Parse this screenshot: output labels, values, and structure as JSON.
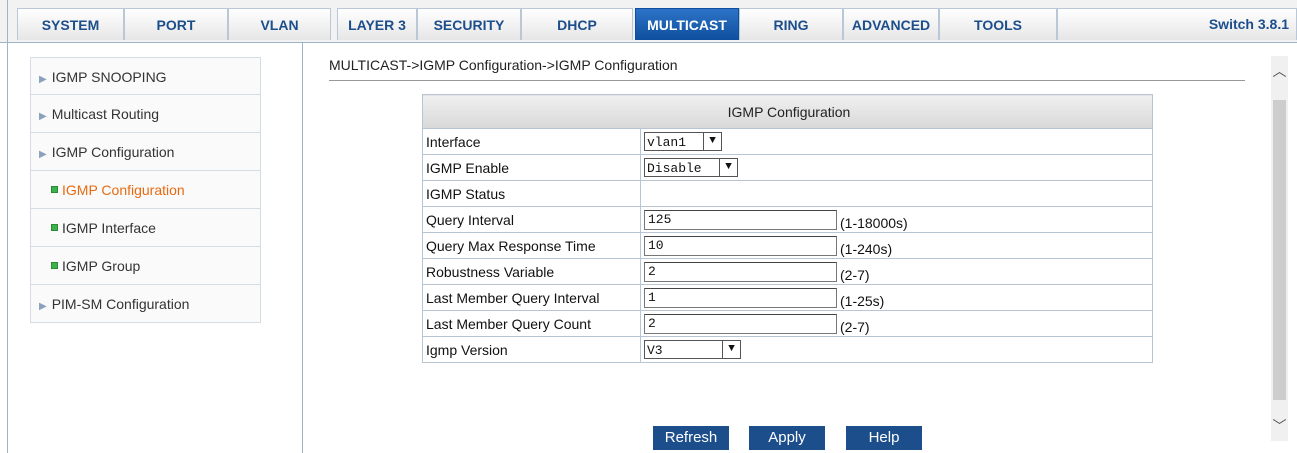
{
  "nav": {
    "tabs": [
      "SYSTEM",
      "PORT",
      "VLAN",
      "LAYER 3",
      "SECURITY",
      "DHCP",
      "MULTICAST",
      "RING",
      "ADVANCED",
      "TOOLS"
    ],
    "active_tab": "MULTICAST",
    "version": "Switch 3.8.1"
  },
  "sidebar": {
    "items": [
      {
        "label": "IGMP SNOOPING"
      },
      {
        "label": "Multicast Routing"
      },
      {
        "label": "IGMP Configuration"
      },
      {
        "label": "IGMP Configuration"
      },
      {
        "label": "IGMP Interface"
      },
      {
        "label": "IGMP Group"
      },
      {
        "label": "PIM-SM Configuration"
      }
    ]
  },
  "breadcrumb": "MULTICAST->IGMP Configuration->IGMP Configuration",
  "form": {
    "title": "IGMP Configuration",
    "rows": {
      "interface": {
        "label": "Interface",
        "value": "vlan1"
      },
      "igmp_enable": {
        "label": "IGMP Enable",
        "value": "Disable"
      },
      "igmp_status": {
        "label": "IGMP Status",
        "value": ""
      },
      "query_interval": {
        "label": "Query Interval",
        "value": "125",
        "range": "(1-18000s)"
      },
      "query_max_response": {
        "label": "Query Max Response Time",
        "value": "10",
        "range": "(1-240s)"
      },
      "robustness": {
        "label": "Robustness Variable",
        "value": "2",
        "range": "(2-7)"
      },
      "last_member_interval": {
        "label": "Last Member Query Interval",
        "value": "1",
        "range": "(1-25s)"
      },
      "last_member_count": {
        "label": "Last Member Query Count",
        "value": "2",
        "range": "(2-7)"
      },
      "igmp_version": {
        "label": "Igmp Version",
        "value": "V3"
      }
    }
  },
  "buttons": {
    "refresh": "Refresh",
    "apply": "Apply",
    "help": "Help"
  },
  "icons": {
    "dropdown": "chevron-down",
    "tree_arrow": "triangle-right",
    "leaf_marker": "green-square",
    "scroll_up": "chevron-up",
    "scroll_down": "chevron-down"
  },
  "colors": {
    "accent": "#1d4e8c",
    "active_tab": "#0f4f9e",
    "active_link": "#e86a10",
    "leaf_marker": "#3bb24a"
  }
}
